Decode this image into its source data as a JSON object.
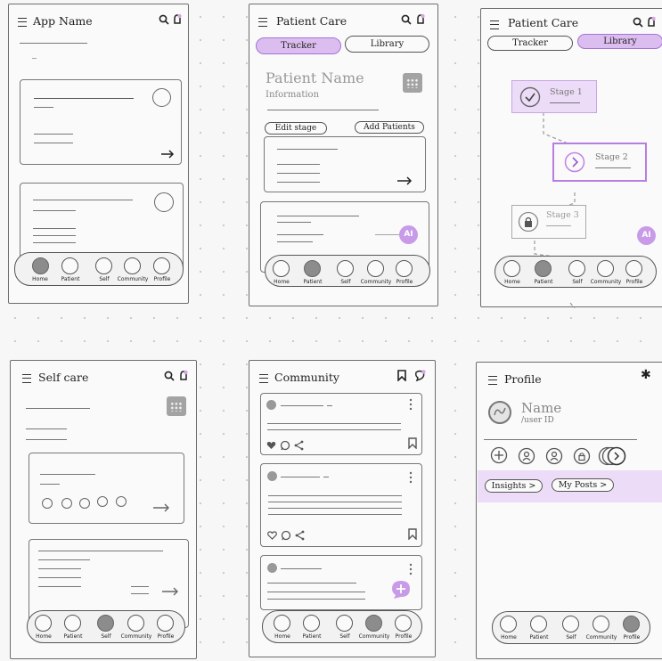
{
  "nav_labels": [
    "Home",
    "Patient",
    "Self",
    "Community",
    "Profile"
  ],
  "screens": {
    "home": {
      "title": "App Name",
      "active_nav": "Home"
    },
    "patient_tracker": {
      "title": "Patient Care",
      "tabs": [
        "Tracker",
        "Library"
      ],
      "active_tab": "Tracker",
      "patient_name": "Patient Name",
      "patient_info": "Information",
      "edit_stage": "Edit stage",
      "add_patients": "Add Patients",
      "ai_label": "AI",
      "active_nav": "Patient"
    },
    "patient_library": {
      "title": "Patient Care",
      "tabs": [
        "Tracker",
        "Library"
      ],
      "active_tab": "Library",
      "stages": [
        {
          "name": "Stage 1",
          "icon": "check-icon",
          "state": "done"
        },
        {
          "name": "Stage 2",
          "icon": "chevron-right-icon",
          "state": "current"
        },
        {
          "name": "Stage 3",
          "icon": "lock-icon",
          "state": "locked"
        }
      ],
      "ai_label": "AI",
      "active_nav": "Patient"
    },
    "self_care": {
      "title": "Self care",
      "active_nav": "Self"
    },
    "community": {
      "title": "Community",
      "active_nav": "Community"
    },
    "profile": {
      "title": "Profile",
      "name": "Name",
      "user_id": "/user ID",
      "insights": "Insights >",
      "my_posts": "My Posts >",
      "active_nav": "Profile"
    }
  },
  "colors": {
    "accent": "#c89be9",
    "accent_light": "#e9d6f7",
    "active_nav": "#8c8c8c"
  }
}
